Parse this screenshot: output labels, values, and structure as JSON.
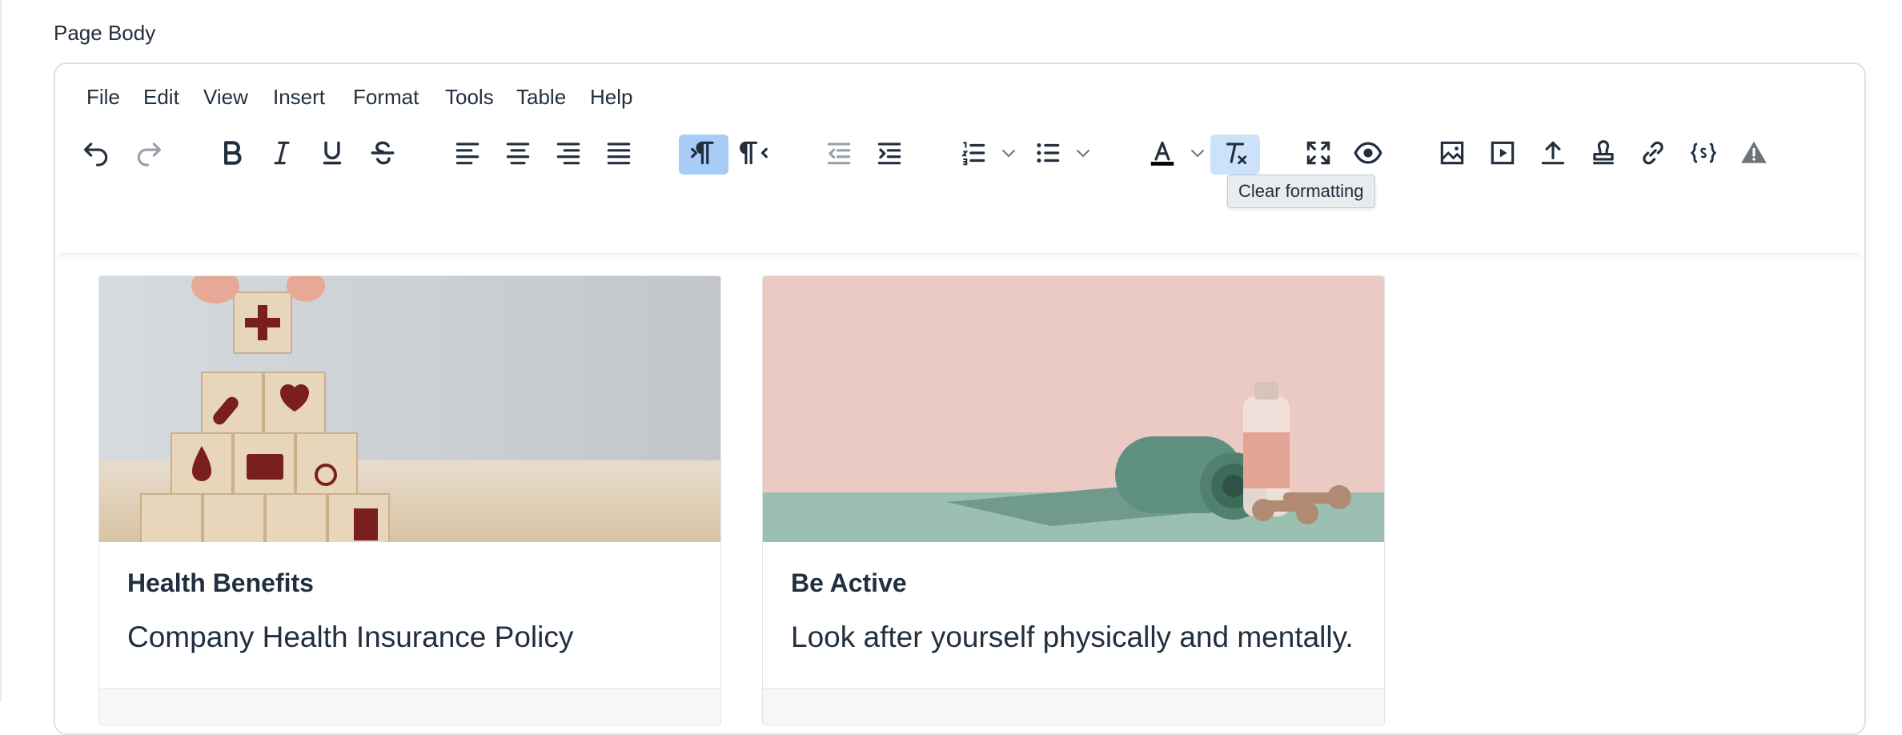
{
  "field": {
    "label": "Page Body"
  },
  "menubar": {
    "file": "File",
    "edit": "Edit",
    "view": "View",
    "insert": "Insert",
    "format": "Format",
    "tools": "Tools",
    "table": "Table",
    "help": "Help"
  },
  "toolbar": {
    "active_button": "ltr-button",
    "hovered_button": "clear-formatting-button",
    "text_color_indicator": "#000000",
    "accent_active": "#a6ccf7",
    "icons": [
      "undo-icon",
      "redo-icon",
      "bold-icon",
      "italic-icon",
      "underline-icon",
      "strikethrough-icon",
      "align-left-icon",
      "align-center-icon",
      "align-right-icon",
      "justify-icon",
      "ltr-icon",
      "rtl-icon",
      "outdent-icon",
      "indent-icon",
      "numbered-list-icon",
      "bullet-list-icon",
      "text-color-icon",
      "clear-formatting-icon",
      "fullscreen-icon",
      "preview-icon",
      "image-icon",
      "media-icon",
      "upload-icon",
      "stamp-icon",
      "link-icon",
      "code-icon",
      "warning-icon"
    ]
  },
  "tooltip": {
    "text": "Clear formatting"
  },
  "cards": [
    {
      "title": "Health Benefits",
      "text": "Company Health Insurance Policy"
    },
    {
      "title": "Be Active",
      "text": "Look after yourself physically and mentally."
    }
  ]
}
